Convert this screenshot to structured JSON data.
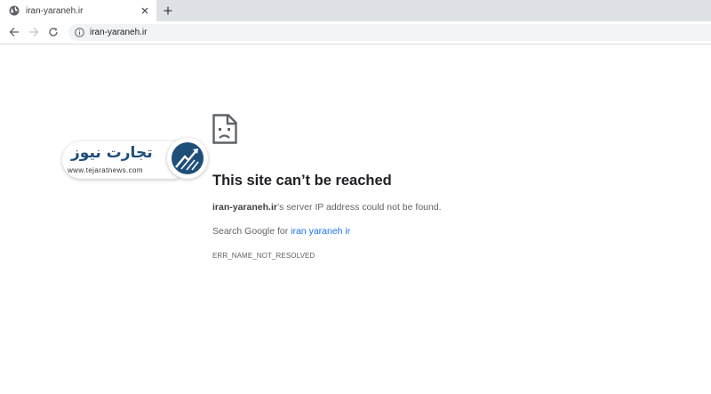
{
  "tab": {
    "title": "iran-yaraneh.ir",
    "favicon": "globe-icon"
  },
  "toolbar": {
    "url": "iran-yaraneh.ir"
  },
  "error": {
    "heading": "This site can’t be reached",
    "host": "iran-yaraneh.ir",
    "detail_suffix": "’s server IP address could not be found.",
    "search_prefix": "Search Google for ",
    "search_link": "iran yaraneh ir",
    "code": "ERR_NAME_NOT_RESOLVED"
  },
  "watermark": {
    "text": "تجارت نیوز",
    "url": "www.tejaratnews.com"
  },
  "colors": {
    "link": "#1a73e8",
    "brand": "#1f4e79"
  }
}
